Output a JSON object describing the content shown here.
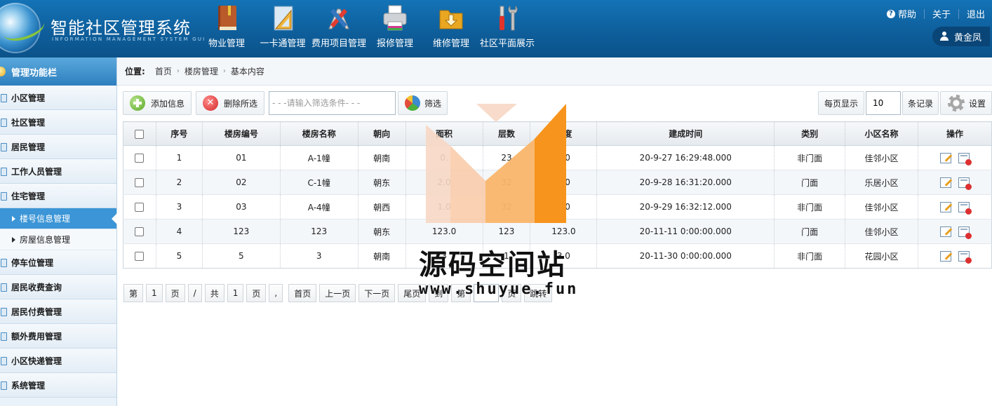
{
  "app": {
    "title": "智能社区管理系统",
    "subtitle": "INFORMATION MANAGEMENT SYSTEM GUI"
  },
  "topnav": [
    {
      "label": "物业管理",
      "icon": "book-icon"
    },
    {
      "label": "一卡通管理",
      "icon": "ruler-triangle-icon"
    },
    {
      "label": "费用项目管理",
      "icon": "tools-pencil-icon"
    },
    {
      "label": "报修管理",
      "icon": "printer-icon"
    },
    {
      "label": "维修管理",
      "icon": "folder-download-icon"
    },
    {
      "label": "社区平面展示",
      "icon": "screwdriver-wrench-icon"
    }
  ],
  "toplinks": {
    "help": "帮助",
    "about": "关于",
    "logout": "退出"
  },
  "user": {
    "name": "黄金凤"
  },
  "sidebar": {
    "header": "管理功能栏",
    "items": [
      {
        "label": "小区管理"
      },
      {
        "label": "社区管理"
      },
      {
        "label": "居民管理"
      },
      {
        "label": "工作人员管理"
      },
      {
        "label": "住宅管理"
      }
    ],
    "subitems": [
      {
        "label": "楼号信息管理",
        "active": true
      },
      {
        "label": "房屋信息管理",
        "active": false
      }
    ],
    "items2": [
      {
        "label": "停车位管理"
      },
      {
        "label": "居民收费查询"
      },
      {
        "label": "居民付费管理"
      },
      {
        "label": "额外费用管理"
      },
      {
        "label": "小区快递管理"
      },
      {
        "label": "系统管理"
      }
    ]
  },
  "breadcrumb": {
    "label": "位置:",
    "items": [
      "首页",
      "楼房管理",
      "基本内容"
    ]
  },
  "toolbar": {
    "add": "添加信息",
    "delete_selected": "删除所选",
    "filter_placeholder": "- - -请输入筛选条件- - -",
    "filter": "筛选",
    "per_page_label": "每页显示",
    "per_page_value": "10",
    "records_label": "条记录",
    "settings": "设置"
  },
  "table": {
    "headers": [
      "序号",
      "楼房编号",
      "楼房名称",
      "朝向",
      "面积",
      "层数",
      "高度",
      "建成时间",
      "类别",
      "小区名称",
      "操作"
    ],
    "rows": [
      [
        "1",
        "01",
        "A-1幢",
        "朝南",
        "0.",
        "23",
        "0.0",
        "20-9-27 16:29:48.000",
        "非门面",
        "佳邻小区"
      ],
      [
        "2",
        "02",
        "C-1幢",
        "朝东",
        "2.0",
        "32",
        "4.0",
        "20-9-28 16:31:20.000",
        "门面",
        "乐居小区"
      ],
      [
        "3",
        "03",
        "A-4幢",
        "朝西",
        "1.0",
        "32",
        "3.0",
        "20-9-29 16:32:12.000",
        "非门面",
        "佳邻小区"
      ],
      [
        "4",
        "123",
        "123",
        "朝东",
        "123.0",
        "123",
        "123.0",
        "20-11-11 0:00:00.000",
        "门面",
        "佳邻小区"
      ],
      [
        "5",
        "5",
        "3",
        "朝南",
        "3",
        "1",
        "3.0",
        "20-11-30 0:00:00.000",
        "非门面",
        "花园小区"
      ]
    ]
  },
  "pager": {
    "di": "第",
    "page": "1",
    "ye": "页",
    "slash": "/",
    "gong": "共",
    "total": "1",
    "ye2": "页",
    "comma": ",",
    "first": "首页",
    "prev": "上一页",
    "next": "下一页",
    "last": "尾页",
    "to": "到",
    "di2": "第",
    "ye3": "页",
    "go": "跳转"
  },
  "watermark": {
    "title": "源码空间站",
    "url": "www.shuyue.fun",
    "colors": [
      "#f7941d",
      "#f9b56a",
      "#f7d7c4"
    ]
  }
}
